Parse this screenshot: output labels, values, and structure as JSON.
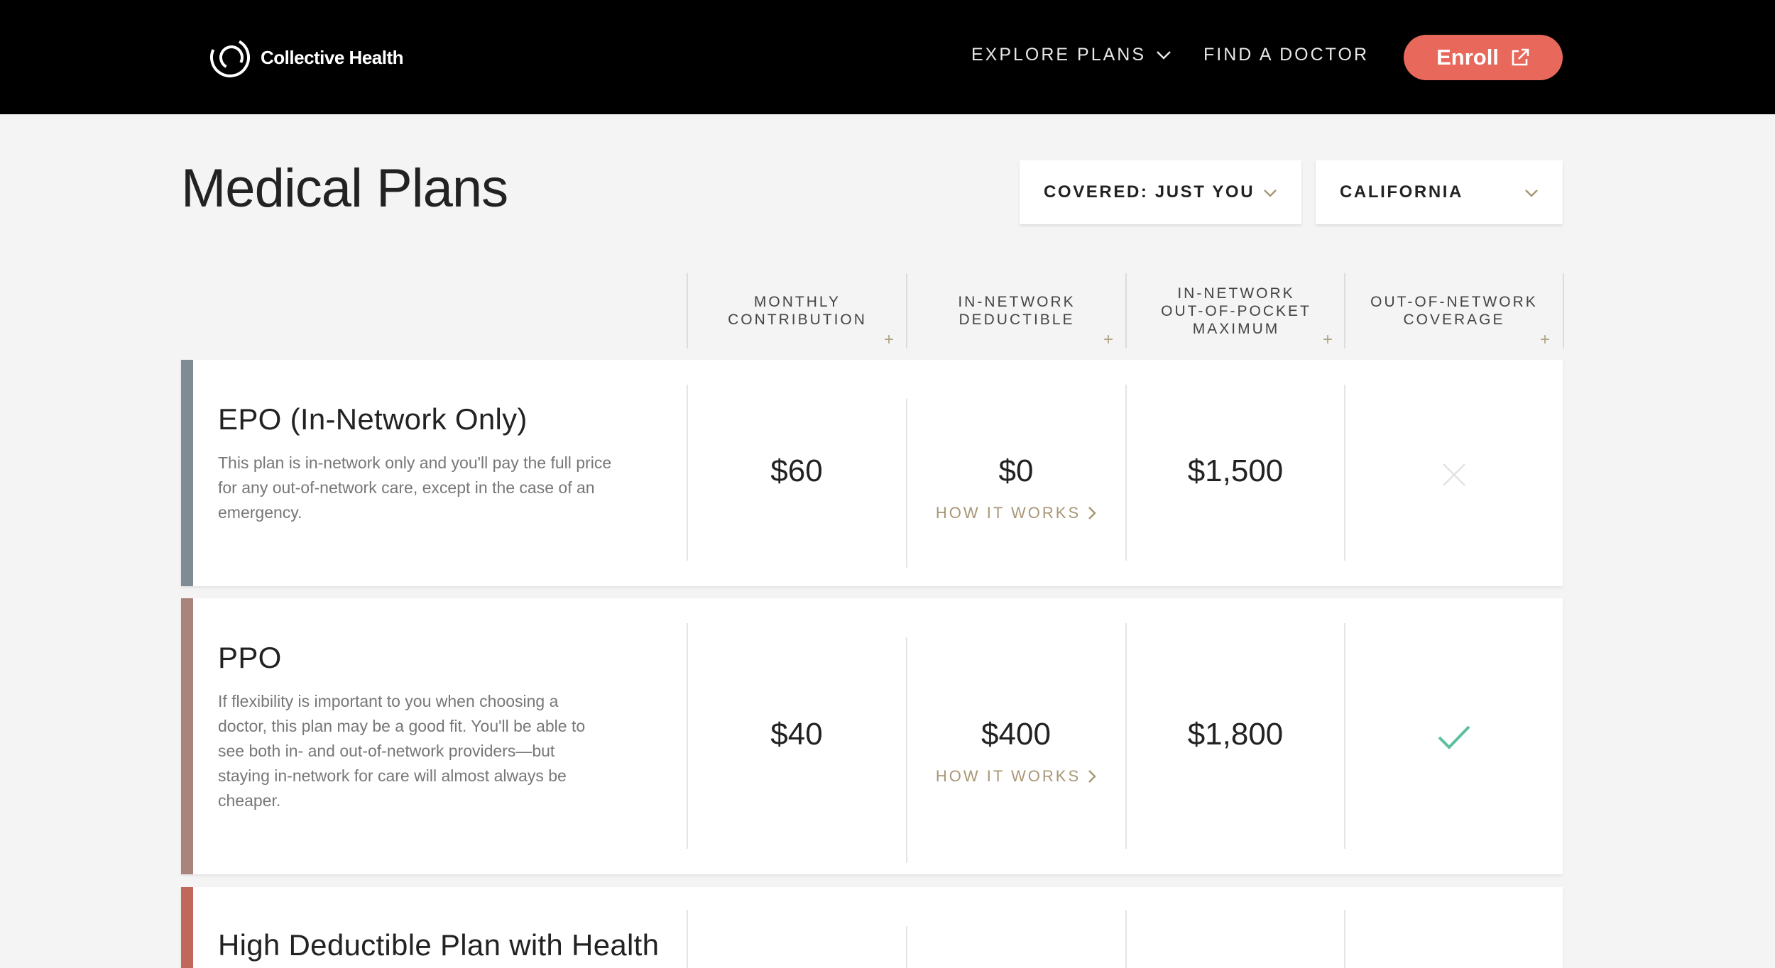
{
  "nav": {
    "brand": "Collective Health",
    "explore_label": "EXPLORE PLANS",
    "find_doctor_label": "FIND A DOCTOR",
    "enroll_label": "Enroll"
  },
  "header": {
    "title": "Medical Plans",
    "coverage_select": "COVERED: JUST YOU",
    "state_select": "CALIFORNIA"
  },
  "columns": [
    {
      "line1": "MONTHLY",
      "line2": "CONTRIBUTION",
      "line3": ""
    },
    {
      "line1": "IN-NETWORK",
      "line2": "DEDUCTIBLE",
      "line3": ""
    },
    {
      "line1": "IN-NETWORK",
      "line2": "OUT-OF-POCKET",
      "line3": "MAXIMUM"
    },
    {
      "line1": "OUT-OF-NETWORK",
      "line2": "COVERAGE",
      "line3": ""
    }
  ],
  "plans": [
    {
      "name": "EPO (In-Network Only)",
      "description": "This plan is in-network only and you'll pay the full price for any out-of-network care, except in the case of an emergency.",
      "monthly": "$60",
      "deductible": "$0",
      "how_it_works": "HOW IT WORKS",
      "oop_max": "$1,500",
      "out_of_network": false,
      "stripe_color": "#7f8c93"
    },
    {
      "name": "PPO",
      "description": "If flexibility is important to you when choosing a doctor, this plan may be a good fit. You'll be able to see both in- and out-of-network providers—but staying in-network for care will almost always be cheaper.",
      "monthly": "$40",
      "deductible": "$400",
      "how_it_works": "HOW IT WORKS",
      "oop_max": "$1,800",
      "out_of_network": true,
      "stripe_color": "#a8847b"
    },
    {
      "name": "High Deductible Plan with Health",
      "stripe_color": "#c0695a"
    }
  ],
  "colors": {
    "accent": "#e8695c",
    "gold": "#a89775",
    "check": "#5cbf9f"
  }
}
